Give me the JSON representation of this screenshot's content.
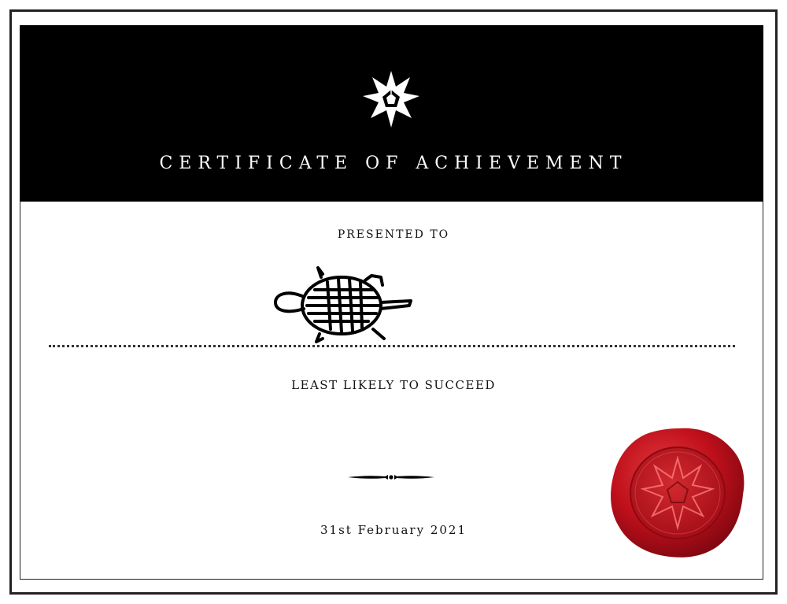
{
  "certificate": {
    "title": "CERTIFICATE OF ACHIEVEMENT",
    "presented_to": "PRESENTED TO",
    "award": "LEAST LIKELY TO SUCCEED",
    "date": "31st February 2021"
  },
  "icons": {
    "emblem": "star-emblem-icon",
    "signature": "turtle-signature-drawing",
    "ornament": "divider-ornament-icon",
    "seal": "red-wax-seal"
  },
  "colors": {
    "header_background": "#000000",
    "header_text": "#ffffff",
    "seal_red": "#c0101b",
    "ink": "#111111"
  }
}
